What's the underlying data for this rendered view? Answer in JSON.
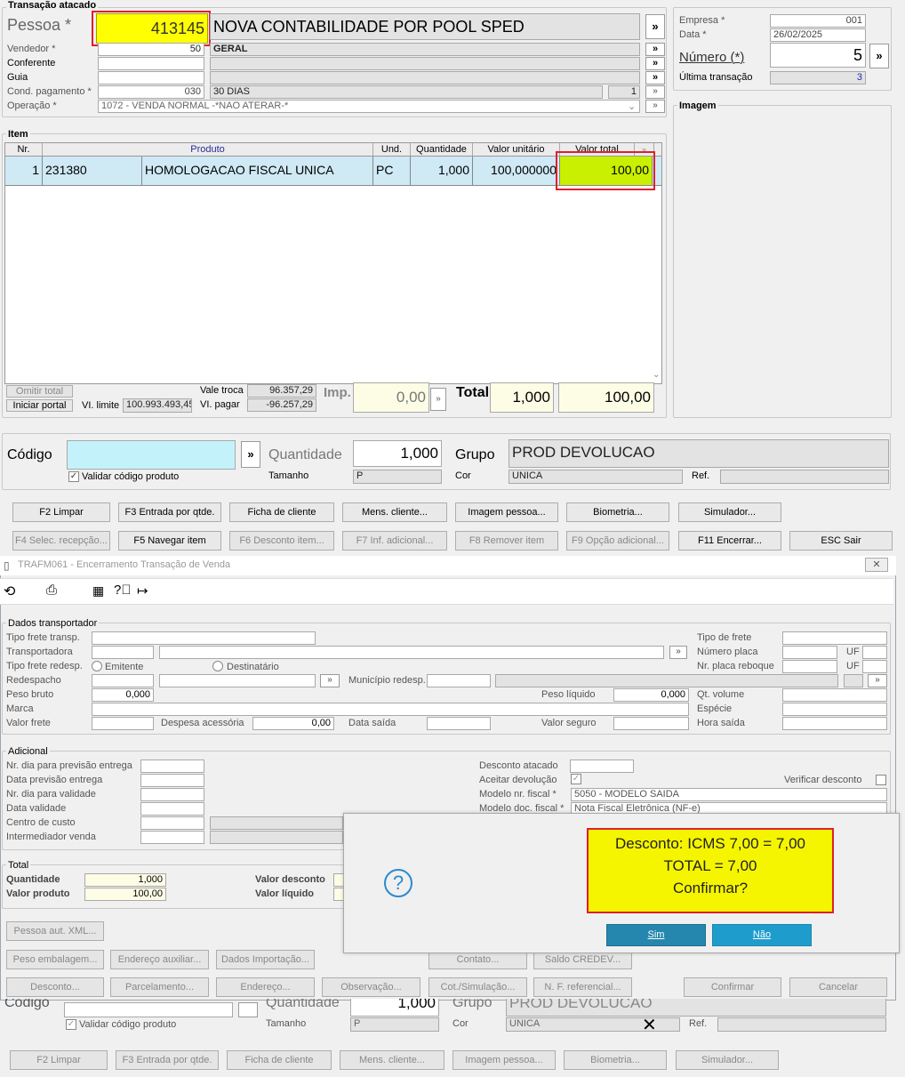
{
  "transacao": {
    "title": "Transação atacado",
    "pessoa_label": "Pessoa *",
    "pessoa_code": "413145",
    "pessoa_name": "NOVA CONTABILIDADE POR POOL SPED",
    "vendedor_label": "Vendedor *",
    "vendedor_code": "50",
    "vendedor_name": "GERAL",
    "conferente_label": "Conferente",
    "guia_label": "Guia",
    "cond_label": "Cond. pagamento *",
    "cond_code": "030",
    "cond_name": "30 DIAS",
    "cond_num": "1",
    "operacao_label": "Operação *",
    "operacao_value": "1072 - VENDA NORMAL -*NAO ATERAR-*"
  },
  "empresa": {
    "empresa_label": "Empresa *",
    "empresa_value": "001",
    "data_label": "Data *",
    "data_value": "26/02/2025",
    "numero_label": "Número (*)",
    "numero_value": "5",
    "ultima_label": "Última transação",
    "ultima_value": "3",
    "imagem_label": "Imagem"
  },
  "item": {
    "title": "Item",
    "columns": [
      "Nr.",
      "Produto",
      "Und.",
      "Quantidade",
      "Valor unitário",
      "Valor total"
    ],
    "row": {
      "nr": "1",
      "codigo": "231380",
      "produto": "HOMOLOGACAO FISCAL UNICA",
      "und": "PC",
      "quantidade": "1,000",
      "valor_unitario": "100,000000",
      "valor_total": "100,00"
    },
    "omitir_label": "Omitir total",
    "iniciar_label": "Iniciar portal",
    "vl_limite_label": "VI. limite",
    "vl_limite_value": "100.993.493,45",
    "vale_troca_label": "Vale troca",
    "vale_troca_value": "96.357,29",
    "vl_pagar_label": "VI. pagar",
    "vl_pagar_value": "-96.257,29",
    "imp_label": "Imp.",
    "imp_value": "0,00",
    "total_label": "Total",
    "total_qtd": "1,000",
    "total_valor": "100,00"
  },
  "codigo_bar": {
    "codigo_label": "Código",
    "validar_label": "Validar código produto",
    "quantidade_label": "Quantidade",
    "quantidade_value": "1,000",
    "tamanho_label": "Tamanho",
    "tamanho_value": "P",
    "grupo_label": "Grupo",
    "grupo_value": "PROD DEVOLUCAO",
    "cor_label": "Cor",
    "cor_value": "UNICA",
    "ref_label": "Ref."
  },
  "buttons_row1": [
    "F2 Limpar",
    "F3 Entrada por qtde.",
    "Ficha de cliente",
    "Mens. cliente...",
    "Imagem pessoa...",
    "Biometria...",
    "Simulador..."
  ],
  "buttons_row2": [
    "F4 Selec. recepção...",
    "F5 Navegar item",
    "F6 Desconto item...",
    "F7 Inf. adicional...",
    "F8 Remover item",
    "F9 Opção adicional...",
    "F11 Encerrar...",
    "ESC Sair"
  ],
  "encerramento": {
    "title": "TRAFM061 - Encerramento Transação de Venda",
    "transportador": {
      "title": "Dados transportador",
      "tipo_frete_transp": "Tipo frete transp.",
      "transportadora": "Transportadora",
      "tipo_frete_redesp": "Tipo frete redesp.",
      "emitente": "Emitente",
      "destinatario": "Destinatário",
      "redespacho": "Redespacho",
      "municipio_redesp": "Município redesp.",
      "peso_bruto": "Peso bruto",
      "peso_bruto_value": "0,000",
      "peso_liquido": "Peso líquido",
      "peso_liquido_value": "0,000",
      "marca": "Marca",
      "valor_frete": "Valor frete",
      "despesa": "Despesa acessória",
      "despesa_value": "0,00",
      "data_saida": "Data saída",
      "valor_seguro": "Valor seguro",
      "tipo_de_frete": "Tipo de frete",
      "numero_placa": "Número placa",
      "nr_placa_reboque": "Nr. placa reboque",
      "uf": "UF",
      "qt_volume": "Qt. volume",
      "especie": "Espécie",
      "hora_saida": "Hora saída"
    },
    "adicional": {
      "title": "Adicional",
      "nr_dia_prev": "Nr. dia para previsão entrega",
      "data_prev": "Data previsão entrega",
      "nr_dia_valid": "Nr. dia para validade",
      "data_validade": "Data validade",
      "centro_custo": "Centro de custo",
      "intermediador": "Intermediador venda",
      "desconto_atacado": "Desconto atacado",
      "aceitar_devolucao": "Aceitar devolução",
      "verificar_desconto": "Verificar desconto",
      "modelo_nr_fiscal": "Modelo nr. fiscal *",
      "modelo_nr_fiscal_value": "5050 - MODELO SAIDA",
      "modelo_doc_fiscal": "Modelo doc. fiscal *",
      "modelo_doc_fiscal_value": "Nota Fiscal Eletrônica (NF-e)"
    },
    "total": {
      "title": "Total",
      "quantidade": "Quantidade",
      "quantidade_value": "1,000",
      "valor_produto": "Valor produto",
      "valor_produto_value": "100,00",
      "valor_desconto": "Valor desconto",
      "valor_liquido": "Valor líquido"
    },
    "buttons": [
      "Pessoa aut. XML...",
      "Peso embalagem...",
      "Endereço auxiliar...",
      "Dados Importação...",
      "Contato...",
      "Saldo CREDEV...",
      "Desconto...",
      "Parcelamento...",
      "Endereço...",
      "Observação...",
      "Cot./Simulação...",
      "N. F. referencial...",
      "Confirmar",
      "Cancelar"
    ]
  },
  "dialog": {
    "line1": "Desconto: ICMS 7,00 = 7,00",
    "line2": "TOTAL = 7,00",
    "line3": "Confirmar?",
    "sim": "Sim",
    "nao": "Não"
  },
  "background_bottom": {
    "codigo_label": "Código",
    "quantidade_label": "Quantidade",
    "quantidade_value": "1,000",
    "grupo_label": "Grupo",
    "grupo_value": "PROD DEVOLUCAO",
    "validar_label": "Validar código produto",
    "tamanho_label": "Tamanho",
    "tamanho_value": "P",
    "cor_label": "Cor",
    "cor_value": "UNICA",
    "ref_label": "Ref.",
    "buttons": [
      "F2 Limpar",
      "F3 Entrada por qtde.",
      "Ficha de cliente",
      "Mens. cliente...",
      "Imagem pessoa...",
      "Biometria...",
      "Simulador..."
    ]
  }
}
